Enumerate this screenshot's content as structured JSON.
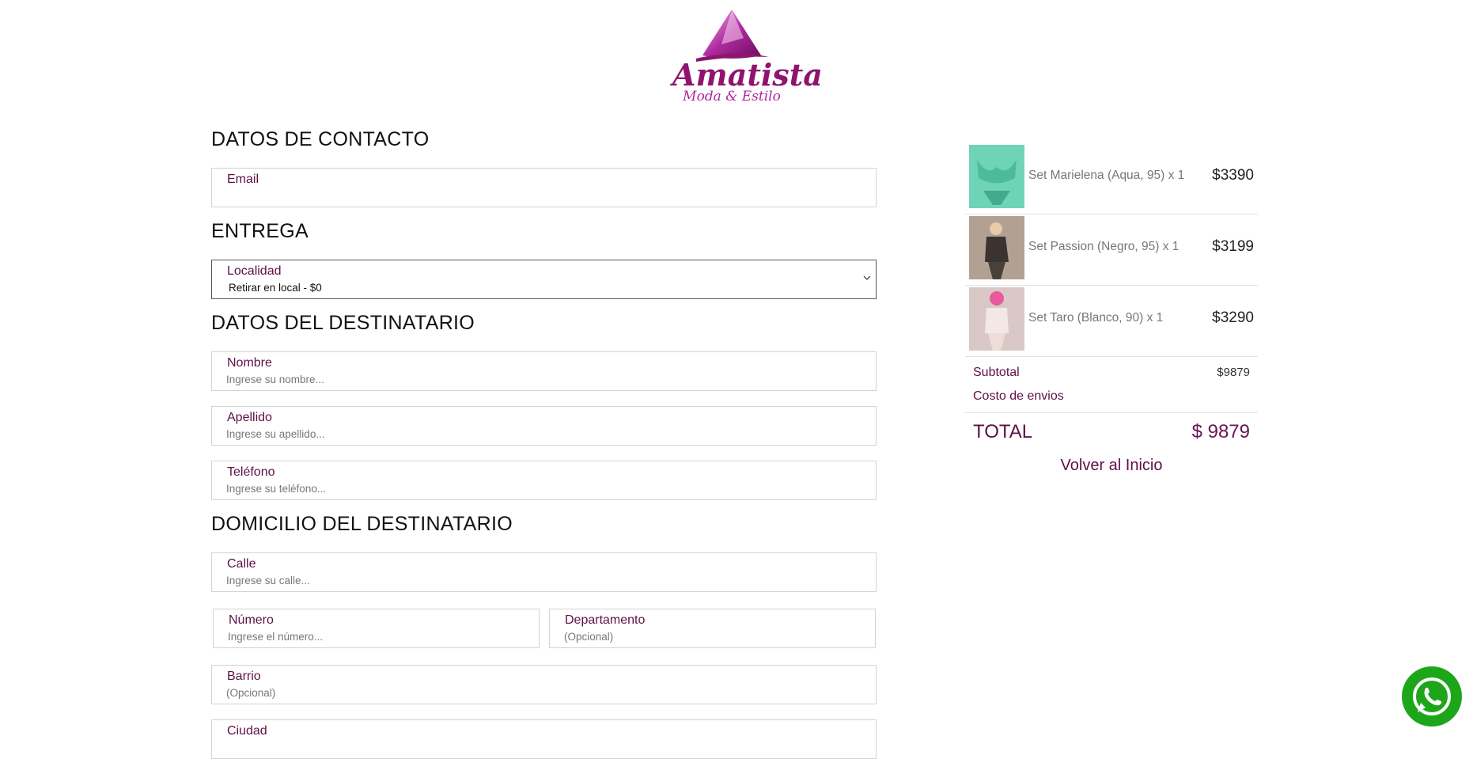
{
  "brand": {
    "name": "Amatista",
    "tagline": "Moda & Estilo",
    "colors": {
      "accent": "#5e1048",
      "brand": "#8e1470",
      "whatsapp": "#1ea61b"
    }
  },
  "sections": {
    "contact": "DATOS DE CONTACTO",
    "delivery": "ENTREGA",
    "recipient": "DATOS DEL DESTINATARIO",
    "address": "DOMICILIO DEL DESTINATARIO"
  },
  "fields": {
    "email": {
      "label": "Email",
      "placeholder": ""
    },
    "localidad": {
      "label": "Localidad",
      "value": "Retirar en local - $0"
    },
    "nombre": {
      "label": "Nombre",
      "placeholder": "Ingrese su nombre..."
    },
    "apellido": {
      "label": "Apellido",
      "placeholder": "Ingrese su apellido..."
    },
    "telefono": {
      "label": "Teléfono",
      "placeholder": "Ingrese su teléfono..."
    },
    "calle": {
      "label": "Calle",
      "placeholder": "Ingrese su calle..."
    },
    "numero": {
      "label": "Número",
      "placeholder": "Ingrese el número..."
    },
    "departamento": {
      "label": "Departamento",
      "placeholder": "(Opcional)"
    },
    "barrio": {
      "label": "Barrio",
      "placeholder": "(Opcional)"
    },
    "ciudad": {
      "label": "Ciudad",
      "placeholder": ""
    }
  },
  "cart": {
    "items": [
      {
        "name": "Set Marielena (Aqua, 95) x 1",
        "price": "$3390",
        "thumb_color": "#6fd3b5"
      },
      {
        "name": "Set Passion (Negro, 95) x 1",
        "price": "$3199",
        "thumb_color": "#9a8a80"
      },
      {
        "name": "Set Taro (Blanco, 90) x 1",
        "price": "$3290",
        "thumb_color": "#d9c8c6"
      }
    ],
    "subtotal_label": "Subtotal",
    "subtotal_value": "$9879",
    "shipping_label": "Costo de envios",
    "total_label": "TOTAL",
    "total_value": "$ 9879",
    "back_link": "Volver al Inicio"
  },
  "icons": {
    "whatsapp": "whatsapp-icon",
    "chevron": "chevron-down-icon"
  }
}
